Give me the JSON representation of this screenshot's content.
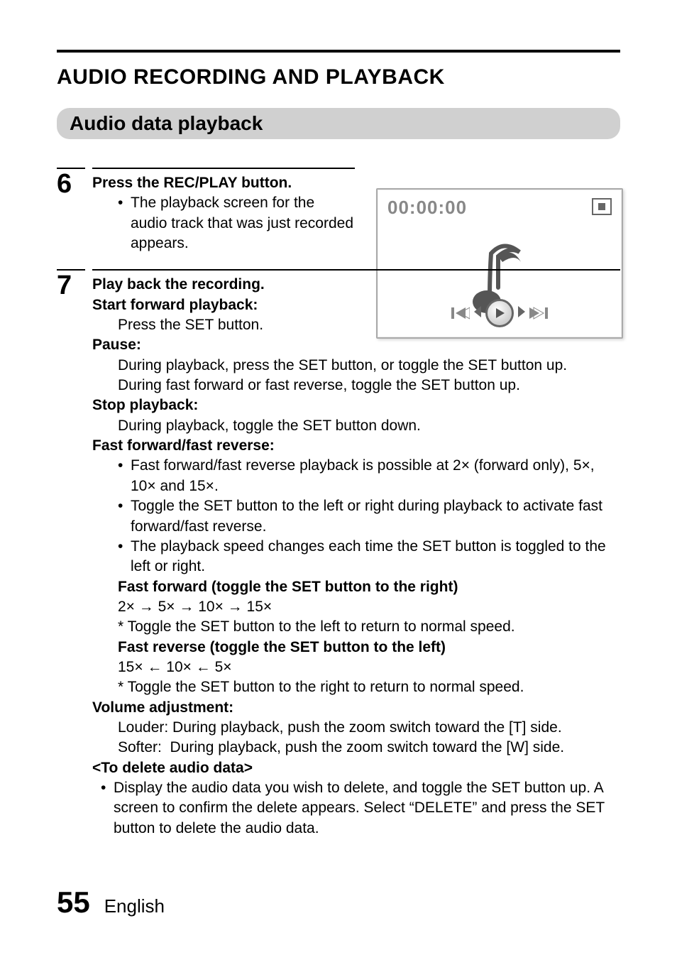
{
  "title": "AUDIO RECORDING AND PLAYBACK",
  "subtitle": "Audio data playback",
  "screen": {
    "time": "00:00:00"
  },
  "step6": {
    "num": "6",
    "heading": "Press the REC/PLAY button.",
    "bullet": "The playback screen for the audio track that was just recorded appears."
  },
  "step7": {
    "num": "7",
    "heading": "Play back the recording.",
    "start_label": "Start forward playback:",
    "start_body": "Press the SET button.",
    "pause_label": "Pause:",
    "pause_body1": "During playback, press the SET button, or toggle the SET button up.",
    "pause_body2": "During fast forward or fast reverse, toggle the SET button up.",
    "stop_label": "Stop playback:",
    "stop_body": "During playback, toggle the SET button down.",
    "ff_label": "Fast forward/fast reverse:",
    "ff_b1": "Fast forward/fast reverse playback is possible at 2× (forward only), 5×, 10× and 15×.",
    "ff_b2": "Toggle the SET button to the left or right during playback to activate fast forward/fast reverse.",
    "ff_b3": "The playback speed changes each time the SET button is toggled to the left or right.",
    "ff_fwd_label": "Fast forward (toggle the SET button to the right)",
    "ff_fwd_seq": "2× → 5× → 10× → 15×",
    "ff_fwd_note": "* Toggle the SET button to the left to return to normal speed.",
    "ff_rev_label": "Fast reverse (toggle the SET button to the left)",
    "ff_rev_seq": "15× ← 10× ← 5×",
    "ff_rev_note": "* Toggle the SET button to the right to return to normal speed.",
    "vol_label": "Volume adjustment:",
    "vol_loud": "Louder: During playback, push the zoom switch toward the [T] side.",
    "vol_soft": "Softer:  During playback, push the zoom switch toward the [W] side.",
    "del_label": "<To delete audio data>",
    "del_body": "Display the audio data you wish to delete, and toggle the SET button up. A screen to confirm the delete appears. Select “DELETE” and press the SET button to delete the audio data."
  },
  "footer": {
    "page": "55",
    "lang": "English"
  }
}
